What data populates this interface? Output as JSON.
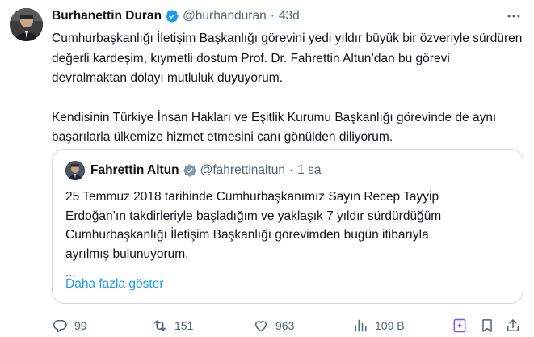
{
  "tweet": {
    "author": {
      "name": "Burhanettin Duran",
      "handle": "@burhanduran",
      "time": "43d",
      "verified": true
    },
    "paragraphs": [
      "Cumhurbaşkanlığı İletişim Başkanlığı görevini yedi yıldır büyük bir özveriyle sürdüren değerli kardeşim, kıymetli dostum Prof. Dr. Fahrettin Altun’dan bu görevi devralmaktan dolayı mutluluk duyuyorum.",
      "Kendisinin Türkiye İnsan Hakları ve Eşitlik Kurumu Başkanlığı görevinde de aynı başarılarla ülkemize hizmet etmesini canı gönülden diliyorum."
    ],
    "quote": {
      "author": {
        "name": "Fahrettin Altun",
        "handle": "@fahrettinaltun",
        "time": "1 sa",
        "verified": true
      },
      "lines": [
        "25 Temmuz 2018 tarihinde Cumhurbaşkanımız Sayın Recep Tayyip",
        "Erdoğan’ın takdirleriyle başladığım ve yaklaşık 7 yıldır sürdürdüğüm",
        "Cumhurbaşkanlığı İletişim Başkanlığı görevimden bugün itibarıyla",
        "ayrılmış bulunuyorum.",
        "..."
      ],
      "show_more": "Daha fazla göster"
    },
    "actions": {
      "replies": "99",
      "reposts": "151",
      "likes": "963",
      "views": "109 B"
    },
    "colors": {
      "accent": "#1d9bf0",
      "muted": "#536471",
      "text": "#0f1419",
      "border": "#cfd9de"
    }
  }
}
